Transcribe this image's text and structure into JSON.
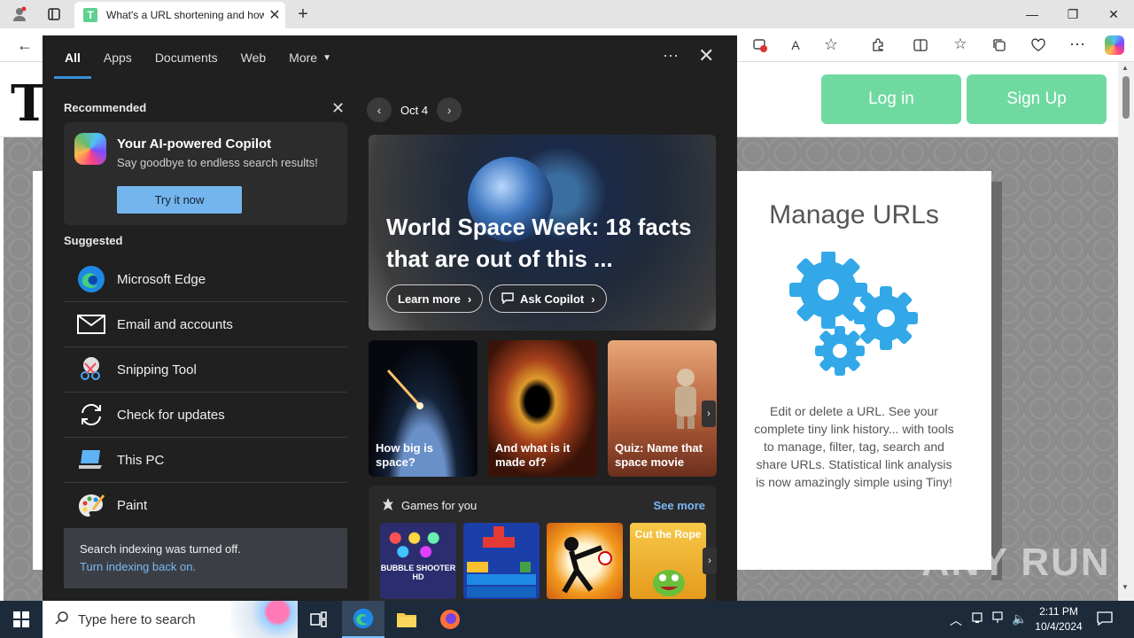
{
  "browser": {
    "tab_title": "What's a URL shortening and how",
    "tab_favicon_letter": "T",
    "icons": [
      "profile-icon",
      "tab-actions-icon",
      "close-tab-icon",
      "new-tab-icon",
      "back-icon",
      "minimize-icon",
      "maximize-icon",
      "close-window-icon",
      "read-aloud-icon",
      "favorite-icon",
      "extensions-icon",
      "split-screen-icon",
      "favorites-icon",
      "collections-icon",
      "performance-icon",
      "more-icon",
      "copilot-icon"
    ]
  },
  "site": {
    "logo_letter": "T",
    "login_label": "Log in",
    "signup_label": "Sign Up",
    "manage_title": "Manage URLs",
    "manage_desc": "Edit or delete a URL. See your complete tiny link history... with tools to manage, filter, tag, search and share URLs. Statistical link analysis is now amazingly simple using Tiny!",
    "accent_color": "#6fd9a0",
    "gear_color": "#33a8e8"
  },
  "search_panel": {
    "tabs": [
      {
        "label": "All"
      },
      {
        "label": "Apps"
      },
      {
        "label": "Documents"
      },
      {
        "label": "Web"
      },
      {
        "label": "More"
      }
    ],
    "recommended_label": "Recommended",
    "reco": {
      "title": "Your AI-powered Copilot",
      "subtitle": "Say goodbye to endless search results!",
      "button": "Try it now"
    },
    "suggested_label": "Suggested",
    "suggestions": [
      {
        "label": "Microsoft Edge",
        "icon": "edge-icon"
      },
      {
        "label": "Email and accounts",
        "icon": "mail-icon"
      },
      {
        "label": "Snipping Tool",
        "icon": "snipping-tool-icon"
      },
      {
        "label": "Check for updates",
        "icon": "update-icon"
      },
      {
        "label": "This PC",
        "icon": "this-pc-icon"
      },
      {
        "label": "Paint",
        "icon": "paint-icon"
      }
    ],
    "indexing": {
      "message": "Search indexing was turned off.",
      "link": "Turn indexing back on."
    },
    "date": "Oct 4",
    "hero": {
      "title": "World Space Week: 18 facts that are out of this ...",
      "learn_more": "Learn more",
      "ask_copilot": "Ask Copilot"
    },
    "cards": [
      {
        "caption": "How big is space?"
      },
      {
        "caption": "And what is it made of?"
      },
      {
        "caption": "Quiz: Name that space movie"
      }
    ],
    "games": {
      "title": "Games for you",
      "see_more": "See more",
      "items": [
        "BUBBLE SHOOTER HD",
        "Block puzzle",
        "Stickman fighter",
        "Cut the Rope"
      ]
    }
  },
  "taskbar": {
    "search_placeholder": "Type here to search",
    "time": "2:11 PM",
    "date": "10/4/2024"
  },
  "watermark": "ANY RUN"
}
